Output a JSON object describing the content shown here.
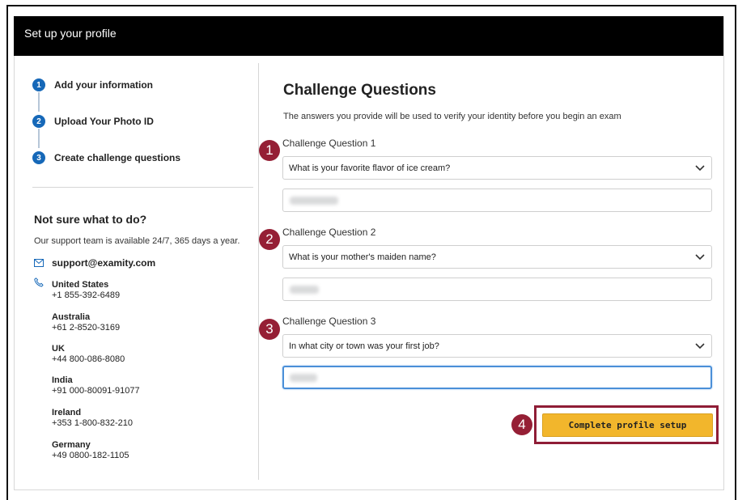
{
  "header": {
    "title": "Set up your profile"
  },
  "steps": [
    {
      "num": "1",
      "label": "Add your information"
    },
    {
      "num": "2",
      "label": "Upload Your Photo ID"
    },
    {
      "num": "3",
      "label": "Create challenge questions"
    }
  ],
  "help": {
    "title": "Not sure what to do?",
    "subtitle": "Our support team is available 24/7, 365 days a year.",
    "email": "support@examity.com",
    "countries": [
      {
        "name": "United States",
        "phone": "+1 855-392-6489"
      },
      {
        "name": "Australia",
        "phone": "+61 2-8520-3169"
      },
      {
        "name": "UK",
        "phone": "+44 800-086-8080"
      },
      {
        "name": "India",
        "phone": "+91 000-80091-91077"
      },
      {
        "name": "Ireland",
        "phone": "+353 1-800-832-210"
      },
      {
        "name": "Germany",
        "phone": "+49 0800-182-1105"
      }
    ]
  },
  "main": {
    "title": "Challenge Questions",
    "description": "The answers you provide will be used to verify your identity before you begin an exam",
    "questions": [
      {
        "marker": "1",
        "label": "Challenge Question 1",
        "selected": "What is your favorite flavor of ice cream?"
      },
      {
        "marker": "2",
        "label": "Challenge Question 2",
        "selected": "What is your mother's maiden name?"
      },
      {
        "marker": "3",
        "label": "Challenge Question 3",
        "selected": "In what city or town was your first job?"
      }
    ],
    "submit_marker": "4",
    "submit_label": "Complete profile setup"
  },
  "colors": {
    "header_bg": "#000000",
    "step_badge": "#1668b8",
    "marker": "#951f35",
    "submit_bg": "#f2b62c",
    "focus_border": "#4a8fd8"
  },
  "icons": {
    "email": "envelope-icon",
    "phone": "phone-icon",
    "dropdown": "chevron-down-icon"
  }
}
